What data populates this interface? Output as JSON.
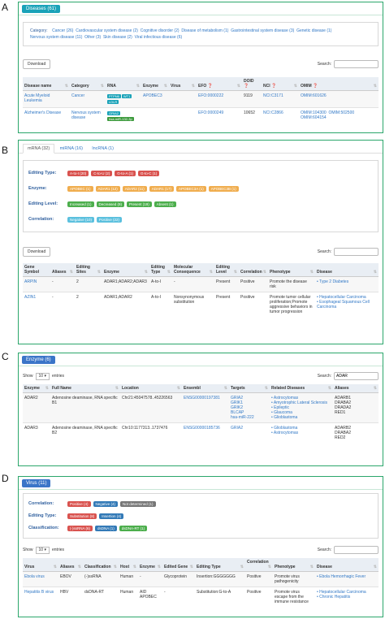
{
  "panel_labels": [
    "A",
    "B",
    "C",
    "D"
  ],
  "a": {
    "header": "Diseases (61)",
    "category_label": "Category:",
    "categories": [
      "Cancer (26)",
      "Cardiovascular system disease (2)",
      "Cognitive disorder (2)",
      "Disease of metabolism (1)",
      "Gastrointestinal system disease (3)",
      "Genetic disease (1)",
      "Nervous system disease (11)",
      "Other (3)",
      "Skin disease (2)",
      "Viral infectious disease (6)"
    ],
    "download": "Download",
    "search_label": "Search:",
    "columns": [
      "Disease name",
      "Category",
      "RNA",
      "Enzyme",
      "Virus",
      "EFO",
      "DOID",
      "NCI",
      "OMIM"
    ],
    "rows": [
      {
        "name": "Acute Myeloid Leukemia",
        "category": "Cancer",
        "rna": [
          "PTPN6",
          "WT1",
          "LDLR"
        ],
        "enzyme": "APOBEC3",
        "virus": "",
        "efo": "EFO:0000222",
        "doid": "9119",
        "nci": "NCI:C3171",
        "omim": [
          "OMIM:601626"
        ]
      },
      {
        "name": "Alzheimer's Disease",
        "category": "Nervous system disease",
        "rna": [
          "GRIA2",
          "hsa-miR-132-3p"
        ],
        "enzyme": "",
        "virus": "",
        "efo": "EFO:0000249",
        "doid": "10652",
        "nci": "NCI:C2866",
        "omim": [
          "OMIM:104300",
          "OMIM:502500",
          "OMIM:604154"
        ]
      }
    ]
  },
  "b": {
    "tabs": [
      "mRNA (32)",
      "miRNA (16)",
      "lncRNA (1)"
    ],
    "filters": [
      {
        "label": "Editing Type:",
        "badges": [
          "A-to-I (20)",
          "C-to-U (2)",
          "G-to-A (1)",
          "G-to-C (1)"
        ]
      },
      {
        "label": "Enzyme:",
        "badges": [
          "APOBEC (1)",
          "ADAR1 (12)",
          "ADAR2 (11)",
          "ADAR1 (17)",
          "APOBEC3A (1)",
          "APOBEC3B (1)"
        ]
      },
      {
        "label": "Editing Level:",
        "badges": [
          "Increased (1)",
          "Decreased (9)",
          "Present (19)",
          "Absent (1)"
        ]
      },
      {
        "label": "Correlation:",
        "badges": [
          "Negative (10)",
          "Positive (22)"
        ]
      }
    ],
    "download": "Download",
    "search_label": "Search:",
    "columns": [
      "Gene Symbol",
      "Aliases",
      "Editing Sites",
      "Enzyme",
      "Editing Type",
      "Molecular Consequence",
      "Editing Level",
      "Correlation",
      "Phenotype",
      "Disease"
    ],
    "rows": [
      {
        "gene": "ARPIN",
        "aliases": "-",
        "sites": "2",
        "enzyme": "ADAR1;ADAR2;ADAR3",
        "type": "A-to-I",
        "consequence": "-",
        "level": "Present",
        "correlation": "Positive",
        "phenotype": "Promote the disease risk",
        "disease": [
          "Type 2 Diabetes"
        ]
      },
      {
        "gene": "AZIN1",
        "aliases": "-",
        "sites": "2",
        "enzyme": "ADAR1;ADAR2",
        "type": "A-to-I",
        "consequence": "Nonsynonymous substitution",
        "level": "Present",
        "correlation": "Positive",
        "phenotype": "Promote tumor cellular proliferation;Promote aggressive behaviors in tumor progression",
        "disease": [
          "Hepatocellular Carcinoma",
          "Esophageal Squamous Cell Carcinoma"
        ]
      }
    ]
  },
  "c": {
    "header": "Enzyme (6)",
    "show_label": "Show",
    "show_value": "10",
    "entries_label": "entries",
    "search_label": "Search:",
    "search_value": "ADAR",
    "columns": [
      "Enzyme",
      "Full Name",
      "Location",
      "Ensembl",
      "Targets",
      "Related Diseases",
      "Aliases"
    ],
    "rows": [
      {
        "enzyme": "ADAR2",
        "full": "Adenosine deaminase, RNA specific B1",
        "location": "Chr21:45047578..45226563",
        "ensembl": "ENSG00000197381",
        "targets": [
          "GRIA2",
          "GRIK1",
          "GRIK2",
          "BLCAP",
          "hsa-miR-222"
        ],
        "diseases": [
          "Astrocytomas",
          "Amyotrophic Lateral Sclerosis",
          "Epileptic",
          "Glaucoma",
          "Glioblastoma"
        ],
        "aliases": [
          "ADARB1",
          "DRABA2",
          "DRADA2",
          "RED1"
        ]
      },
      {
        "enzyme": "ADAR3",
        "full": "Adenosine deaminase, RNA specific B2",
        "location": "Chr10:1177313..1737476",
        "ensembl": "ENSG00000185736",
        "targets": [
          "GRIA2"
        ],
        "diseases": [
          "Glioblastoma",
          "Astrocytomas"
        ],
        "aliases": [
          "ADARB2",
          "DRABA2",
          "RED2"
        ]
      }
    ]
  },
  "d": {
    "header": "Virus (11)",
    "filters": [
      {
        "label": "Correlation:",
        "badges": [
          {
            "text": "Positive (4)",
            "color": "red"
          },
          {
            "text": "Negative (4)",
            "color": "darkblue"
          },
          {
            "text": "Not determined (1)",
            "color": "grey"
          }
        ]
      },
      {
        "label": "Editing Type:",
        "badges": [
          {
            "text": "Substitution (8)",
            "color": "red"
          },
          {
            "text": "Insertion (4)",
            "color": "darkblue"
          }
        ]
      },
      {
        "label": "Classification:",
        "badges": [
          {
            "text": "(-)ssRNA (6)",
            "color": "red"
          },
          {
            "text": "dsDNA (1)",
            "color": "darkblue"
          },
          {
            "text": "dsDNA-RT (1)",
            "color": "green"
          }
        ]
      }
    ],
    "show_label": "Show",
    "show_value": "10",
    "entries_label": "entries",
    "search_label": "Search:",
    "columns": [
      "Virus",
      "Aliases",
      "Classification",
      "Host",
      "Enzyme",
      "Edited Gene",
      "Editing Type",
      "Correlation",
      "Phenotype",
      "Disease"
    ],
    "rows": [
      {
        "virus": "Ebola virus",
        "aliases": "EBOV",
        "class": "(-)ssRNA",
        "host": "Human",
        "enzyme": "-",
        "gene": "Glycoprotein",
        "type": "Insertion:GGGGGGG",
        "correlation": "Positive",
        "phenotype": "Promote virus pathogenicity",
        "disease": [
          "Ebola Hemorrhagic Fever"
        ]
      },
      {
        "virus": "Hepatitis B virus",
        "aliases": "HBV",
        "class": "dsDNA-RT",
        "host": "Human",
        "enzyme": "AID APOBEC",
        "gene": "-",
        "type": "Substitution:G-to-A",
        "correlation": "Positive",
        "phenotype": "Promote virus escape from the immune resistance",
        "disease": [
          "Hepatocellular Carcinoma",
          "Chronic Hepatitis"
        ]
      }
    ]
  },
  "colors": {
    "panel_border": "#2ba66b",
    "header_tag": "#19a2b8",
    "link": "#3178c6"
  }
}
